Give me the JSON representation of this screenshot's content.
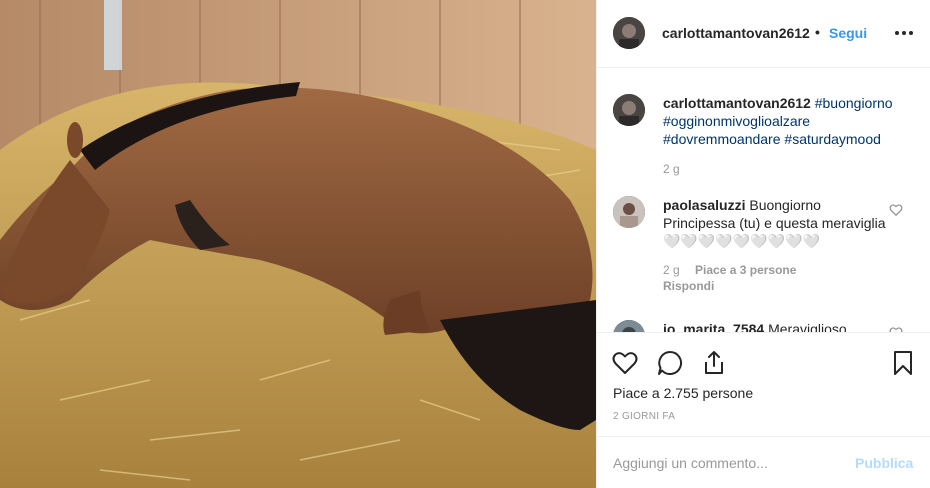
{
  "post": {
    "image_alt": "horse lying on straw",
    "author": "carlottamantovan2612",
    "follow_label": "Segui",
    "header_separator": "•"
  },
  "caption": {
    "username": "carlottamantovan2612",
    "hashtags": [
      "#buongiorno",
      "#ogginonmivoglioalzare",
      "#dovremmoandare",
      "#saturdaymood"
    ],
    "time": "2 g"
  },
  "comments": [
    {
      "username": "paolasaluzzi",
      "text": "Buongiorno Principessa (tu) e questa meraviglia🤍🤍🤍🤍🤍🤍🤍🤍🤍",
      "time": "2 g",
      "likes": "Piace a 3 persone",
      "reply_label": "Rispondi"
    },
    {
      "username": "jo_marita_7584",
      "text": "Meraviglioso"
    }
  ],
  "actions": {
    "likes_text": "Piace a 2.755 persone",
    "date": "2 GIORNI FA"
  },
  "add_comment": {
    "placeholder": "Aggiungi un commento...",
    "publish_label": "Pubblica"
  },
  "colors": {
    "link": "#3897f0",
    "hashtag": "#003569",
    "muted": "#999999",
    "publish_disabled": "#b3dbff"
  }
}
